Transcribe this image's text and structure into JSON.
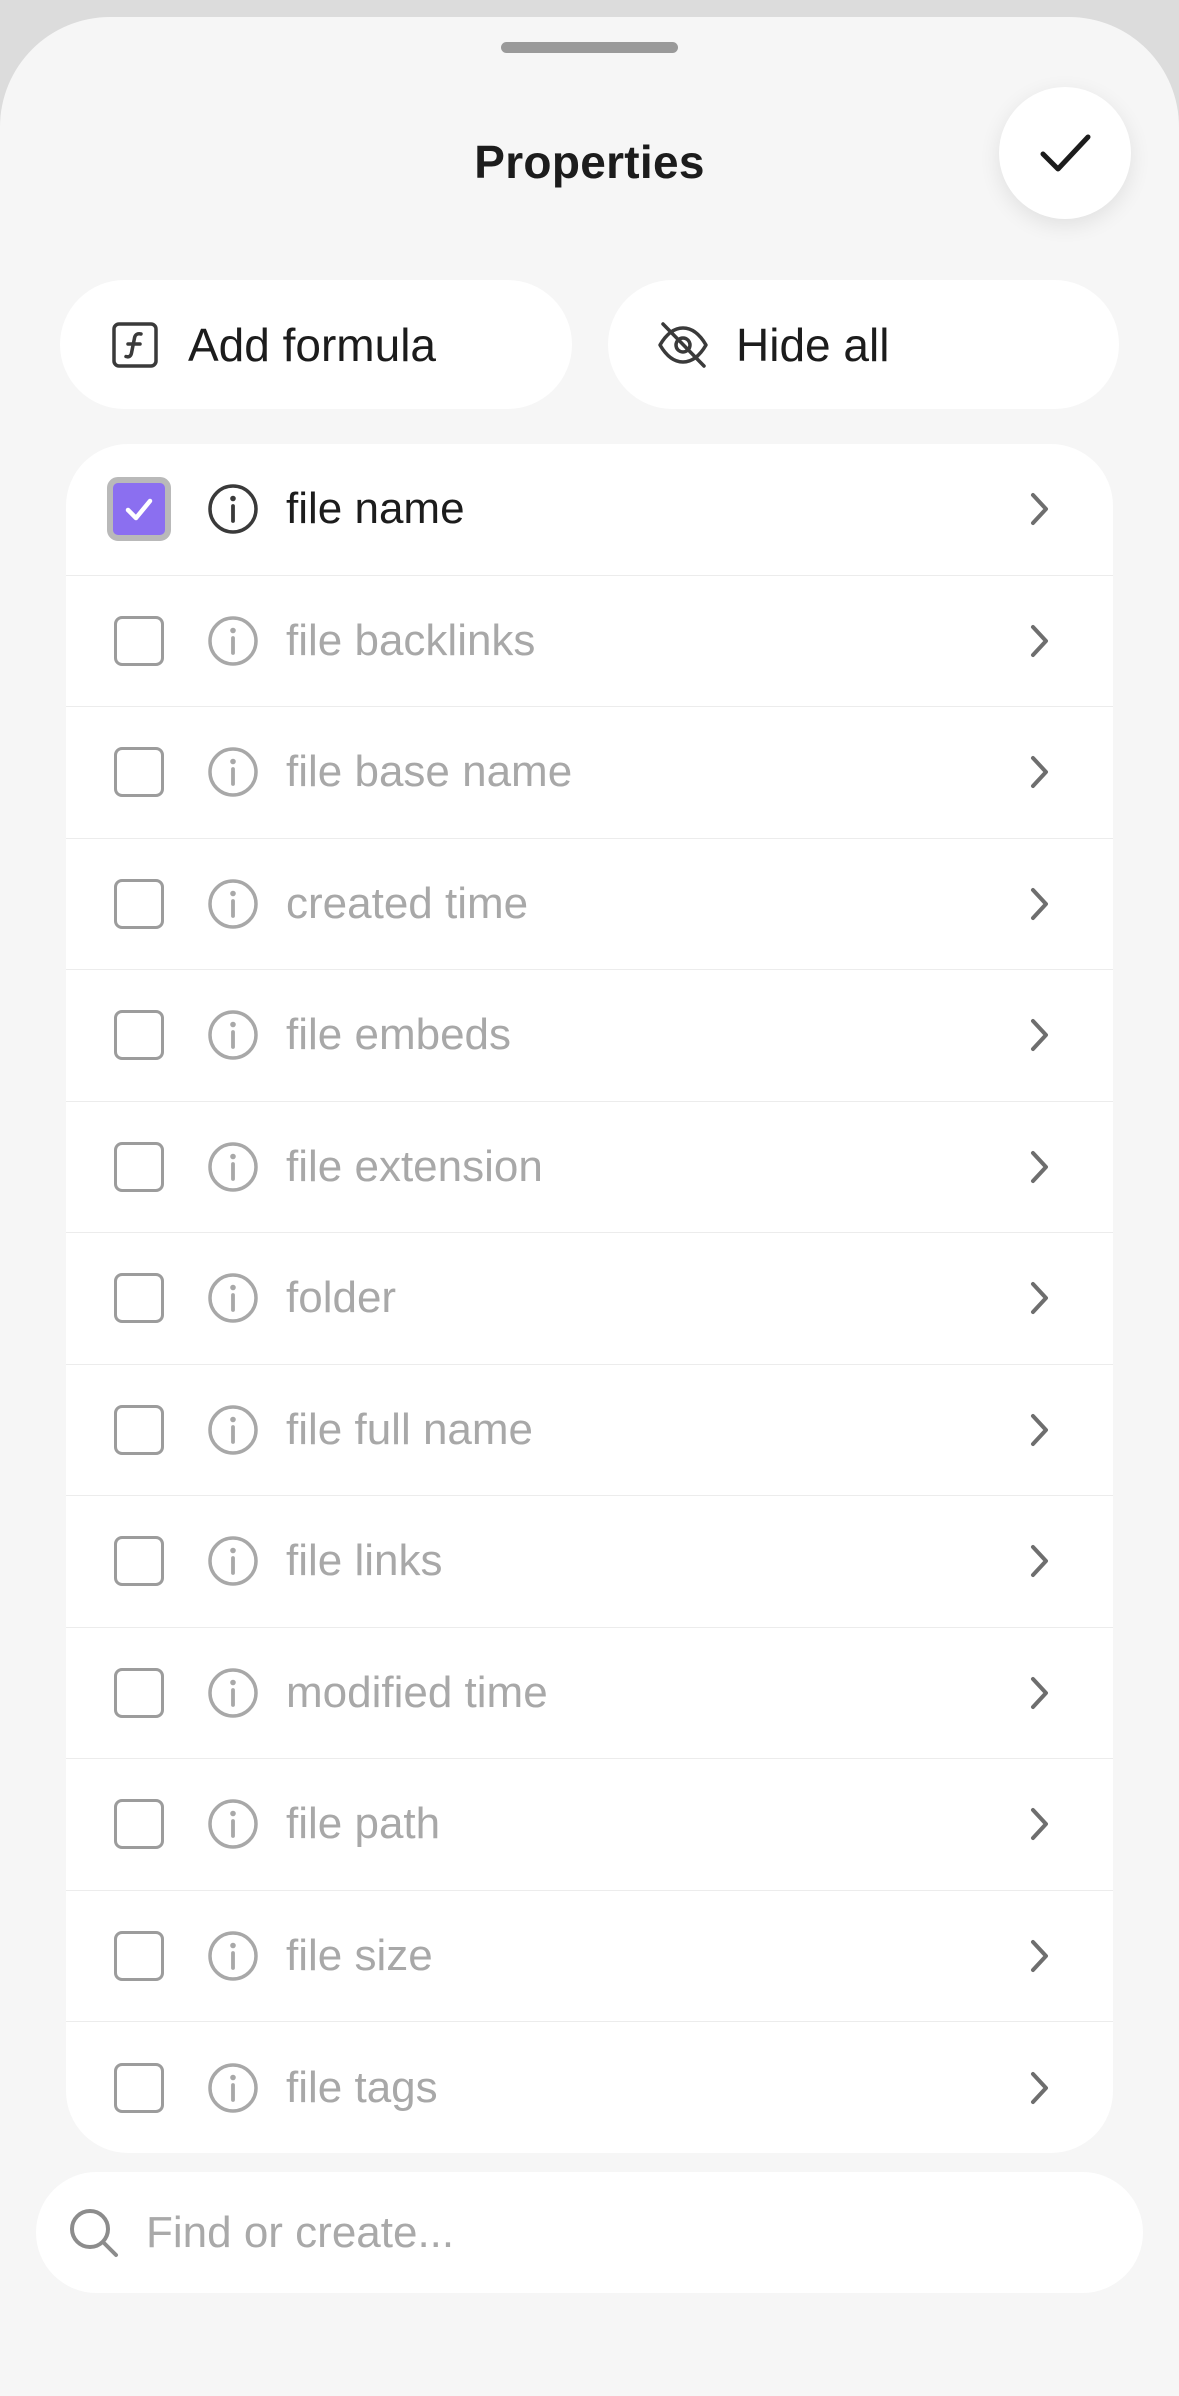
{
  "sheet": {
    "title": "Properties",
    "done_icon": "checkmark-icon"
  },
  "actions": {
    "add_formula": {
      "label": "Add formula",
      "icon": "formula-icon"
    },
    "hide_all": {
      "label": "Hide all",
      "icon": "eye-off-icon"
    }
  },
  "colors": {
    "accent": "#8b6ff0",
    "text_active": "#1c1c1c",
    "text_inactive": "#a8a8a8",
    "background": "#f6f6f6"
  },
  "properties": [
    {
      "label": "file name",
      "checked": true
    },
    {
      "label": "file backlinks",
      "checked": false
    },
    {
      "label": "file base name",
      "checked": false
    },
    {
      "label": "created time",
      "checked": false
    },
    {
      "label": "file embeds",
      "checked": false
    },
    {
      "label": "file extension",
      "checked": false
    },
    {
      "label": "folder",
      "checked": false
    },
    {
      "label": "file full name",
      "checked": false
    },
    {
      "label": "file links",
      "checked": false
    },
    {
      "label": "modified time",
      "checked": false
    },
    {
      "label": "file path",
      "checked": false
    },
    {
      "label": "file size",
      "checked": false
    },
    {
      "label": "file tags",
      "checked": false
    }
  ],
  "search": {
    "placeholder": "Find or create...",
    "value": "",
    "icon": "search-icon"
  }
}
